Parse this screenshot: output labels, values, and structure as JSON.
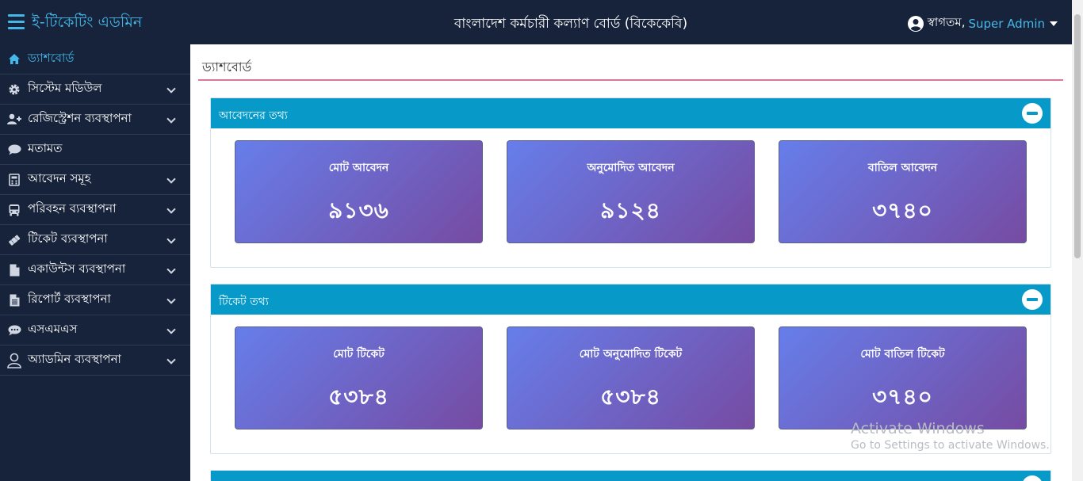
{
  "header": {
    "brand": "ই-টিকেটিং এডমিন",
    "org_title": "বাংলাদেশ কর্মচারী কল্যাণ বোর্ড (বিকেকেবি)",
    "welcome": "স্বাগতম,",
    "username": "Super Admin"
  },
  "sidebar": {
    "items": [
      {
        "label": "ড্যাশবোর্ড",
        "icon": "home-icon"
      },
      {
        "label": "সিস্টেম মডিউল",
        "icon": "gear-icon"
      },
      {
        "label": "রেজিস্ট্রেশন ব্যবস্থাপনা",
        "icon": "user-plus-icon"
      },
      {
        "label": "মতামত",
        "icon": "comment-icon"
      },
      {
        "label": "আবেদন সমূহ",
        "icon": "calculator-icon"
      },
      {
        "label": "পরিবহন ব্যবস্থাপনা",
        "icon": "bus-icon"
      },
      {
        "label": "টিকেট ব্যবস্থাপনা",
        "icon": "ticket-icon"
      },
      {
        "label": "একাউন্টস ব্যবস্থাপনা",
        "icon": "file-icon"
      },
      {
        "label": "রিপোর্ট ব্যবস্থাপনা",
        "icon": "file-text-icon"
      },
      {
        "label": "এসএমএস",
        "icon": "chat-dots-icon"
      },
      {
        "label": "অ্যাডমিন ব্যবস্থাপনা",
        "icon": "user-outline-icon"
      }
    ]
  },
  "main": {
    "page_title": "ড্যাশবোর্ড",
    "panels": [
      {
        "title": "আবেদনের তথ্য",
        "cards": [
          {
            "label": "মোট আবেদন",
            "value": "৯১৩৬"
          },
          {
            "label": "অনুমোদিত আবেদন",
            "value": "৯১২৪"
          },
          {
            "label": "বাতিল আবেদন",
            "value": "৩৭৪০"
          }
        ]
      },
      {
        "title": "টিকেট তথ্য",
        "cards": [
          {
            "label": "মোট টিকেট",
            "value": "৫৩৮৪"
          },
          {
            "label": "মোট অনুমোদিত টিকেট",
            "value": "৫৩৮৪"
          },
          {
            "label": "মোট বাতিল টিকেট",
            "value": "৩৭৪০"
          }
        ]
      }
    ]
  },
  "watermark": {
    "line1": "Activate Windows",
    "line2": "Go to Settings to activate Windows."
  },
  "colors": {
    "topbar_bg": "#17233a",
    "accent": "#45b8ea",
    "panel_head": "#079ac9",
    "title_rule": "#e0759a",
    "card_gradient_start": "#667eea",
    "card_gradient_end": "#764ba2"
  }
}
